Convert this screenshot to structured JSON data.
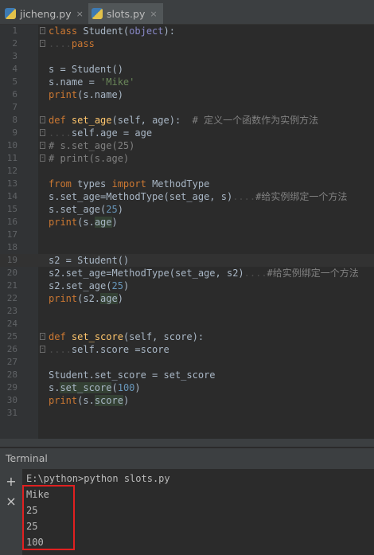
{
  "tabs": [
    {
      "label": "jicheng.py",
      "close": "×"
    },
    {
      "label": "slots.py",
      "close": "×"
    }
  ],
  "editor": {
    "current_line": 19,
    "lines": [
      {
        "n": "1",
        "html": "<span class='kw'>class</span> Student(<span class='bi'>object</span>):"
      },
      {
        "n": "2",
        "html": "<span class='dot'>....</span><span class='kw'>pass</span>"
      },
      {
        "n": "3",
        "html": ""
      },
      {
        "n": "4",
        "html": "s = Student()"
      },
      {
        "n": "5",
        "html": "s.name = <span class='str'>'Mike'</span>"
      },
      {
        "n": "6",
        "html": "<span class='kw'>print</span>(s.name)"
      },
      {
        "n": "7",
        "html": ""
      },
      {
        "n": "8",
        "html": "<span class='kw'>def</span> <span class='fn'>set_age</span>(self, age):  <span class='cm'># 定义一个函数作为实例方法</span>"
      },
      {
        "n": "9",
        "html": "<span class='dot'>....</span>self.age = age"
      },
      {
        "n": "10",
        "html": "<span class='cm'># s.set_age(25)</span>"
      },
      {
        "n": "11",
        "html": "<span class='cm'># print(s.age)</span>"
      },
      {
        "n": "12",
        "html": ""
      },
      {
        "n": "13",
        "html": "<span class='kw'>from</span> types <span class='kw'>import</span> MethodType"
      },
      {
        "n": "14",
        "html": "s.set_age=MethodType(set_age, s)<span class='dot'>....</span><span class='cm'>#给实例绑定一个方法</span>"
      },
      {
        "n": "15",
        "html": "s.set_age(<span class='num'>25</span>)"
      },
      {
        "n": "16",
        "html": "<span class='kw'>print</span>(s.<span class='hl'>age</span>)"
      },
      {
        "n": "17",
        "html": ""
      },
      {
        "n": "18",
        "html": ""
      },
      {
        "n": "19",
        "html": "s2 = Student()"
      },
      {
        "n": "20",
        "html": "s2.set_age=MethodType(set_age, s2)<span class='dot'>....</span><span class='cm'>#给实例绑定一个方法</span>"
      },
      {
        "n": "21",
        "html": "s2.set_age(<span class='num'>25</span>)"
      },
      {
        "n": "22",
        "html": "<span class='kw'>print</span>(s2.<span class='hl'>age</span>)"
      },
      {
        "n": "23",
        "html": ""
      },
      {
        "n": "24",
        "html": ""
      },
      {
        "n": "25",
        "html": "<span class='kw'>def</span> <span class='fn'>set_score</span>(self, score):"
      },
      {
        "n": "26",
        "html": "<span class='dot'>....</span>self.score =score"
      },
      {
        "n": "27",
        "html": ""
      },
      {
        "n": "28",
        "html": "Student.set_score = set_score"
      },
      {
        "n": "29",
        "html": "s.<span class='hl'>set_score</span>(<span class='num'>100</span>)"
      },
      {
        "n": "30",
        "html": "<span class='kw'>print</span>(s.<span class='hl'>score</span>)"
      },
      {
        "n": "31",
        "html": ""
      }
    ]
  },
  "terminal": {
    "title": "Terminal",
    "add_icon": "+",
    "close_icon": "×",
    "lines": [
      "E:\\python>python slots.py",
      "Mike",
      "25",
      "25",
      "100"
    ]
  }
}
